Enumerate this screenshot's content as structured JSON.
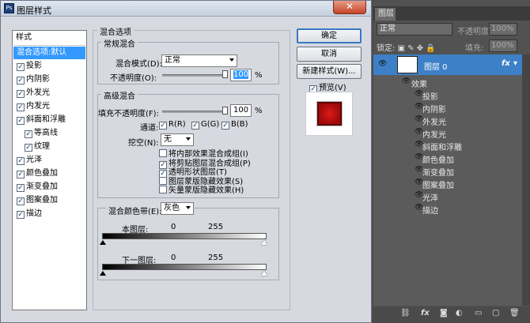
{
  "dialog": {
    "title": "图层样式",
    "close_glyph": "✕",
    "style_list": {
      "header": "样式",
      "items": [
        {
          "label": "混合选项:默认",
          "checkbox": false,
          "selected": true
        },
        {
          "label": "投影",
          "checkbox": true,
          "checked": true
        },
        {
          "label": "内阴影",
          "checkbox": true,
          "checked": true
        },
        {
          "label": "外发光",
          "checkbox": true,
          "checked": true
        },
        {
          "label": "内发光",
          "checkbox": true,
          "checked": true
        },
        {
          "label": "斜面和浮雕",
          "checkbox": true,
          "checked": true
        },
        {
          "label": "等高线",
          "checkbox": true,
          "checked": true,
          "indent": true
        },
        {
          "label": "纹理",
          "checkbox": true,
          "checked": true,
          "indent": true
        },
        {
          "label": "光泽",
          "checkbox": true,
          "checked": true
        },
        {
          "label": "颜色叠加",
          "checkbox": true,
          "checked": true
        },
        {
          "label": "渐变叠加",
          "checkbox": true,
          "checked": true
        },
        {
          "label": "图案叠加",
          "checkbox": true,
          "checked": true
        },
        {
          "label": "描边",
          "checkbox": true,
          "checked": true
        }
      ]
    },
    "blend_options": {
      "title": "混合选项",
      "general": {
        "title": "常规混合",
        "mode_label": "混合模式(D):",
        "mode_value": "正常",
        "opacity_label": "不透明度(O):",
        "opacity_value": "100",
        "opacity_unit": "%"
      },
      "advanced": {
        "title": "高级混合",
        "fill_label": "填充不透明度(F):",
        "fill_value": "100",
        "fill_unit": "%",
        "channels_label": "通道:",
        "channels": [
          "R(R)",
          "G(G)",
          "B(B)"
        ],
        "knockout_label": "挖空(N):",
        "knockout_value": "无",
        "options": [
          {
            "label": "将内部效果混合成组(I)",
            "checked": false
          },
          {
            "label": "将剪贴图层混合成组(P)",
            "checked": true
          },
          {
            "label": "透明形状图层(T)",
            "checked": true
          },
          {
            "label": "图层蒙版隐藏效果(S)",
            "checked": false
          },
          {
            "label": "矢量蒙版隐藏效果(H)",
            "checked": false
          }
        ]
      },
      "blend_if": {
        "label": "混合颜色带(E):",
        "value": "灰色",
        "this_layer_label": "本图层:",
        "this_layer_min": "0",
        "this_layer_max": "255",
        "under_layer_label": "下一图层:",
        "under_layer_min": "0",
        "under_layer_max": "255"
      }
    },
    "buttons": {
      "ok": "确定",
      "cancel": "取消",
      "new_style": "新建样式(W)...",
      "preview_label": "预览(V)"
    }
  },
  "layers_panel": {
    "tab": "图层",
    "blend_mode": "正常",
    "opacity_label": "不透明度:",
    "opacity_value": "100%",
    "lock_label": "锁定:",
    "fill_label": "填充:",
    "fill_value": "100%",
    "layer_name": "图层 0",
    "fx_badge": "fx",
    "effects_label": "效果",
    "effects": [
      "投影",
      "内阴影",
      "外发光",
      "内发光",
      "斜面和浮雕",
      "颜色叠加",
      "渐变叠加",
      "图案叠加",
      "光泽",
      "描边"
    ],
    "bottom_icons": [
      "link-icon",
      "fx-icon",
      "mask-icon",
      "adjustment-icon",
      "folder-icon",
      "new-layer-icon",
      "trash-icon"
    ]
  },
  "colors": {
    "selection": "#3399ff",
    "dialog_bg": "#d6d9df",
    "panel_bg": "#525252",
    "layer_selected": "#3d80c8",
    "preview_swatch": "#c81414"
  }
}
